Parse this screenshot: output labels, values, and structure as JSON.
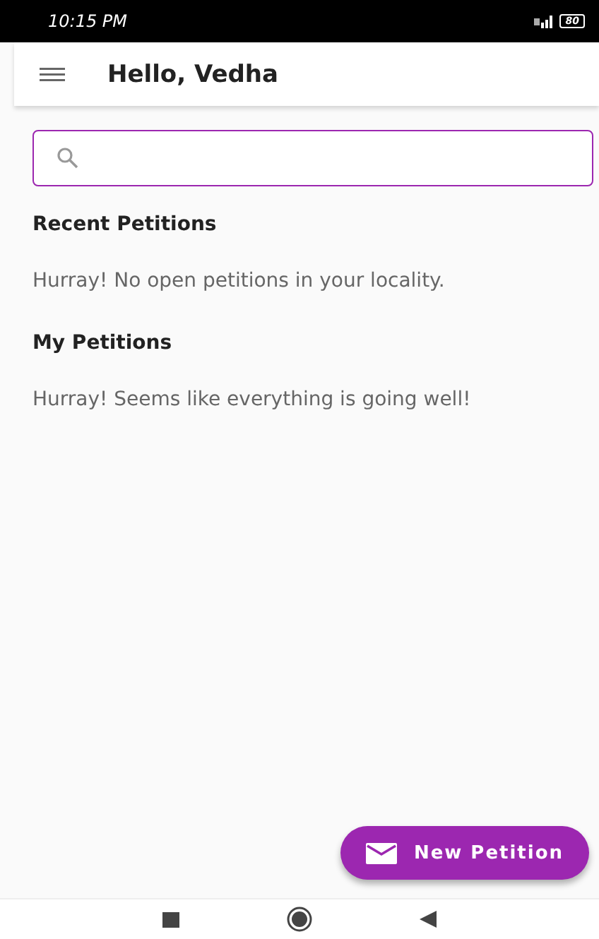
{
  "status_bar": {
    "time": "10:15 PM",
    "battery": "80"
  },
  "app_bar": {
    "title": "Hello, Vedha"
  },
  "sections": [
    {
      "title": "Recent Petitions",
      "message": "Hurray! No open petitions in your locality."
    },
    {
      "title": "My Petitions",
      "message": "Hurray! Seems like everything is going well!"
    }
  ],
  "fab": {
    "label": "New Petition"
  }
}
